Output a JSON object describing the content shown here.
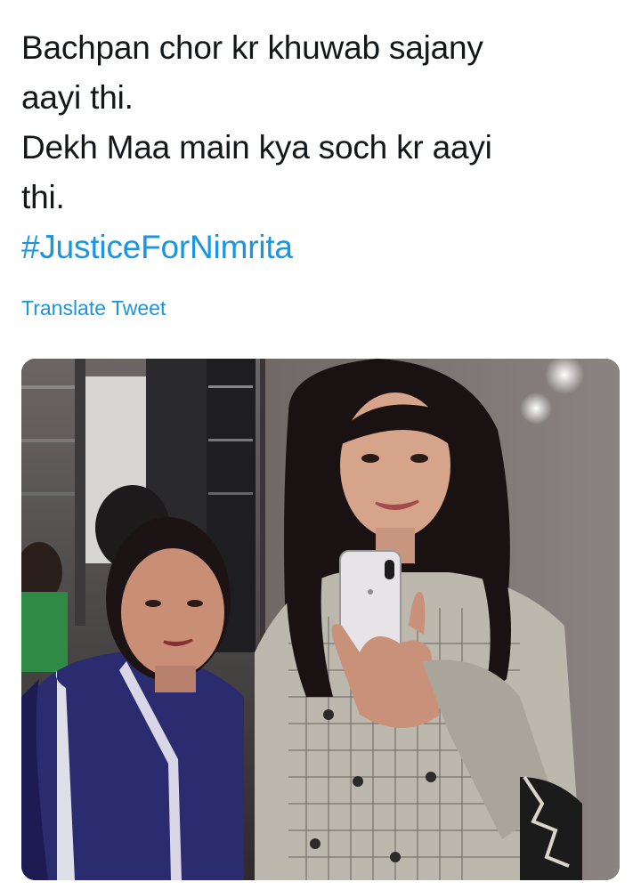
{
  "tweet": {
    "text_lines": [
      "Bachpan chor kr khuwab sajany",
      "aayi thi.",
      "Dekh Maa main kya soch kr aayi",
      "thi."
    ],
    "hashtag": "#JusticeForNimrita",
    "translate_label": "Translate Tweet"
  },
  "colors": {
    "text": "#14171a",
    "link": "#1b95e0",
    "background": "#ffffff"
  },
  "media": {
    "kind": "photo"
  }
}
